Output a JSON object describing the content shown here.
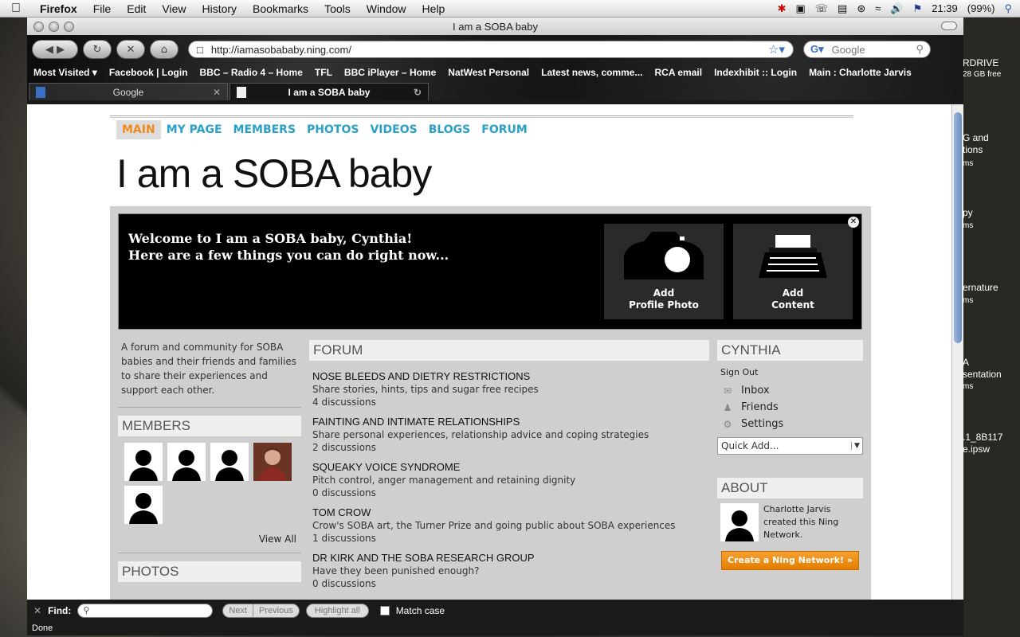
{
  "menubar": {
    "app": "Firefox",
    "items": [
      "File",
      "Edit",
      "View",
      "History",
      "Bookmarks",
      "Tools",
      "Window",
      "Help"
    ],
    "clock": "21:39",
    "battery": "(99%)"
  },
  "desktop_labels": [
    "RDRIVE",
    "28 GB free",
    "G and",
    "tions",
    "ms",
    "py",
    "ms",
    "ernature",
    "ms",
    "A",
    "sentation",
    "ms",
    ".1_8B117",
    "e.ipsw"
  ],
  "window": {
    "title": "I am a SOBA baby",
    "url": "http://iamasobababy.ning.com/",
    "search_placeholder": "Google",
    "bookmarks": [
      "Most Visited ▾",
      "Facebook | Login",
      "BBC – Radio 4 – Home",
      "TFL",
      "BBC iPlayer – Home",
      "NatWest Personal",
      "Latest news, comme...",
      "RCA email",
      "Indexhibit :: Login",
      "Main : Charlotte Jarvis"
    ],
    "tabs": [
      {
        "label": "Google",
        "active": false
      },
      {
        "label": "I am a SOBA baby",
        "active": true
      }
    ]
  },
  "site": {
    "nav": [
      "MAIN",
      "MY PAGE",
      "MEMBERS",
      "PHOTOS",
      "VIDEOS",
      "BLOGS",
      "FORUM"
    ],
    "active_nav": "MAIN",
    "title": "I am a SOBA baby",
    "welcome_line1": "Welcome to I am a SOBA baby, Cynthia!",
    "welcome_line2": "Here are a few things you can do right now...",
    "cards": [
      {
        "line1": "Add",
        "line2": "Profile Photo",
        "icon": "camera-icon"
      },
      {
        "line1": "Add",
        "line2": "Content",
        "icon": "typewriter-icon"
      }
    ],
    "description": "A forum and community for SOBA babies and their friends and families to share their experiences and support each other.",
    "members_header": "MEMBERS",
    "view_all": "View All",
    "photos_header": "PHOTOS",
    "forum_header": "FORUM",
    "topics": [
      {
        "title": "NOSE BLEEDS AND DIETRY RESTRICTIONS",
        "desc": "Share stories, hints, tips and sugar free recipes",
        "count": "4 discussions"
      },
      {
        "title": "FAINTING AND INTIMATE RELATIONSHIPS",
        "desc": "Share personal experiences, relationship advice and coping strategies",
        "count": "2 discussions"
      },
      {
        "title": "SQUEAKY VOICE SYNDROME",
        "desc": "Pitch control, anger management and retaining dignity",
        "count": "0 discussions"
      },
      {
        "title": "TOM CROW",
        "desc": "Crow's SOBA art, the Turner Prize and going public about SOBA experiences",
        "count": "1 discussions"
      },
      {
        "title": "DR KIRK AND THE SOBA RESEARCH GROUP",
        "desc": "Have they been punished enough?",
        "count": "0 discussions"
      }
    ],
    "user_header": "CYNTHIA",
    "sign_out": "Sign Out",
    "user_links": [
      {
        "label": "Inbox",
        "icon": "envelope-icon"
      },
      {
        "label": "Friends",
        "icon": "person-icon"
      },
      {
        "label": "Settings",
        "icon": "gear-icon"
      }
    ],
    "quick_add": "Quick Add...",
    "about_header": "ABOUT",
    "creator_text": "Charlotte Jarvis created this Ning Network.",
    "ning_button": "Create a Ning Network! »"
  },
  "findbar": {
    "label": "Find:",
    "next": "Next",
    "previous": "Previous",
    "highlight": "Highlight all",
    "match_case": "Match case"
  },
  "status": "Done",
  "colors": {
    "nav_link": "#2aa0c8",
    "nav_active": "#f08a1c",
    "ning_button": "#e47d00"
  }
}
